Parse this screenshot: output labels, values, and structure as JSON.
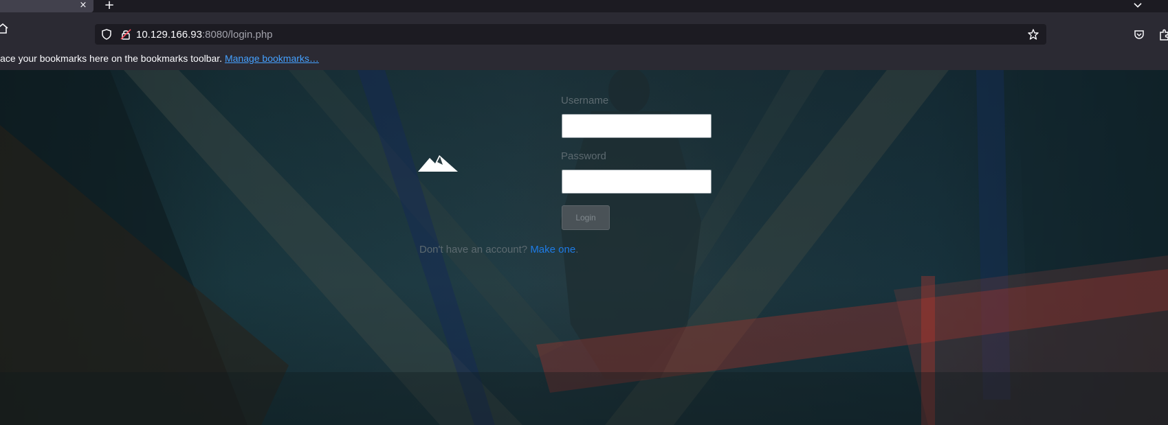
{
  "browser": {
    "tab_close_glyph": "×",
    "new_tab_glyph": "+",
    "url_host": "10.129.166.93",
    "url_path": ":8080/login.php",
    "bookmarks_message": "lace your bookmarks here on the bookmarks toolbar. ",
    "manage_bookmarks_label": "Manage bookmarks…",
    "icons": [
      "home-icon",
      "shield-icon",
      "lock-icon",
      "star-icon",
      "pocket-icon",
      "extensions-icon",
      "chevron-down-icon"
    ]
  },
  "login": {
    "username_label": "Username",
    "password_label": "Password",
    "login_button_label": "Login",
    "signup_prompt": "Don't have an account? ",
    "signup_link_label": "Make one",
    "signup_suffix": ".",
    "logo_icon": "mountain-icon"
  },
  "colors": {
    "link": "#1e7be6",
    "label": "#5d6a70"
  }
}
